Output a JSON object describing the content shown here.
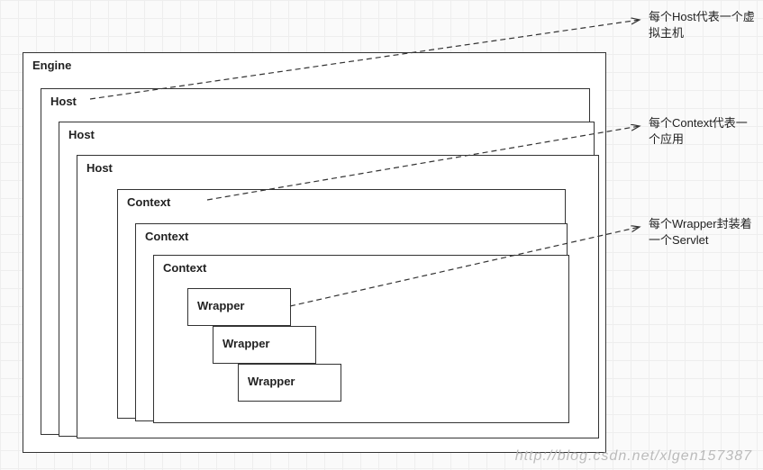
{
  "engine": {
    "label": "Engine"
  },
  "hosts": [
    {
      "label": "Host"
    },
    {
      "label": "Host"
    },
    {
      "label": "Host"
    }
  ],
  "contexts": [
    {
      "label": "Context"
    },
    {
      "label": "Context"
    },
    {
      "label": "Context"
    }
  ],
  "wrappers": [
    {
      "label": "Wrapper"
    },
    {
      "label": "Wrapper"
    },
    {
      "label": "Wrapper"
    }
  ],
  "annotations": {
    "host": "每个Host代表一个虚拟主机",
    "context": "每个Context代表一个应用",
    "wrapper": "每个Wrapper封装着一个Servlet"
  },
  "watermark": "http://blog.csdn.net/xlgen157387"
}
